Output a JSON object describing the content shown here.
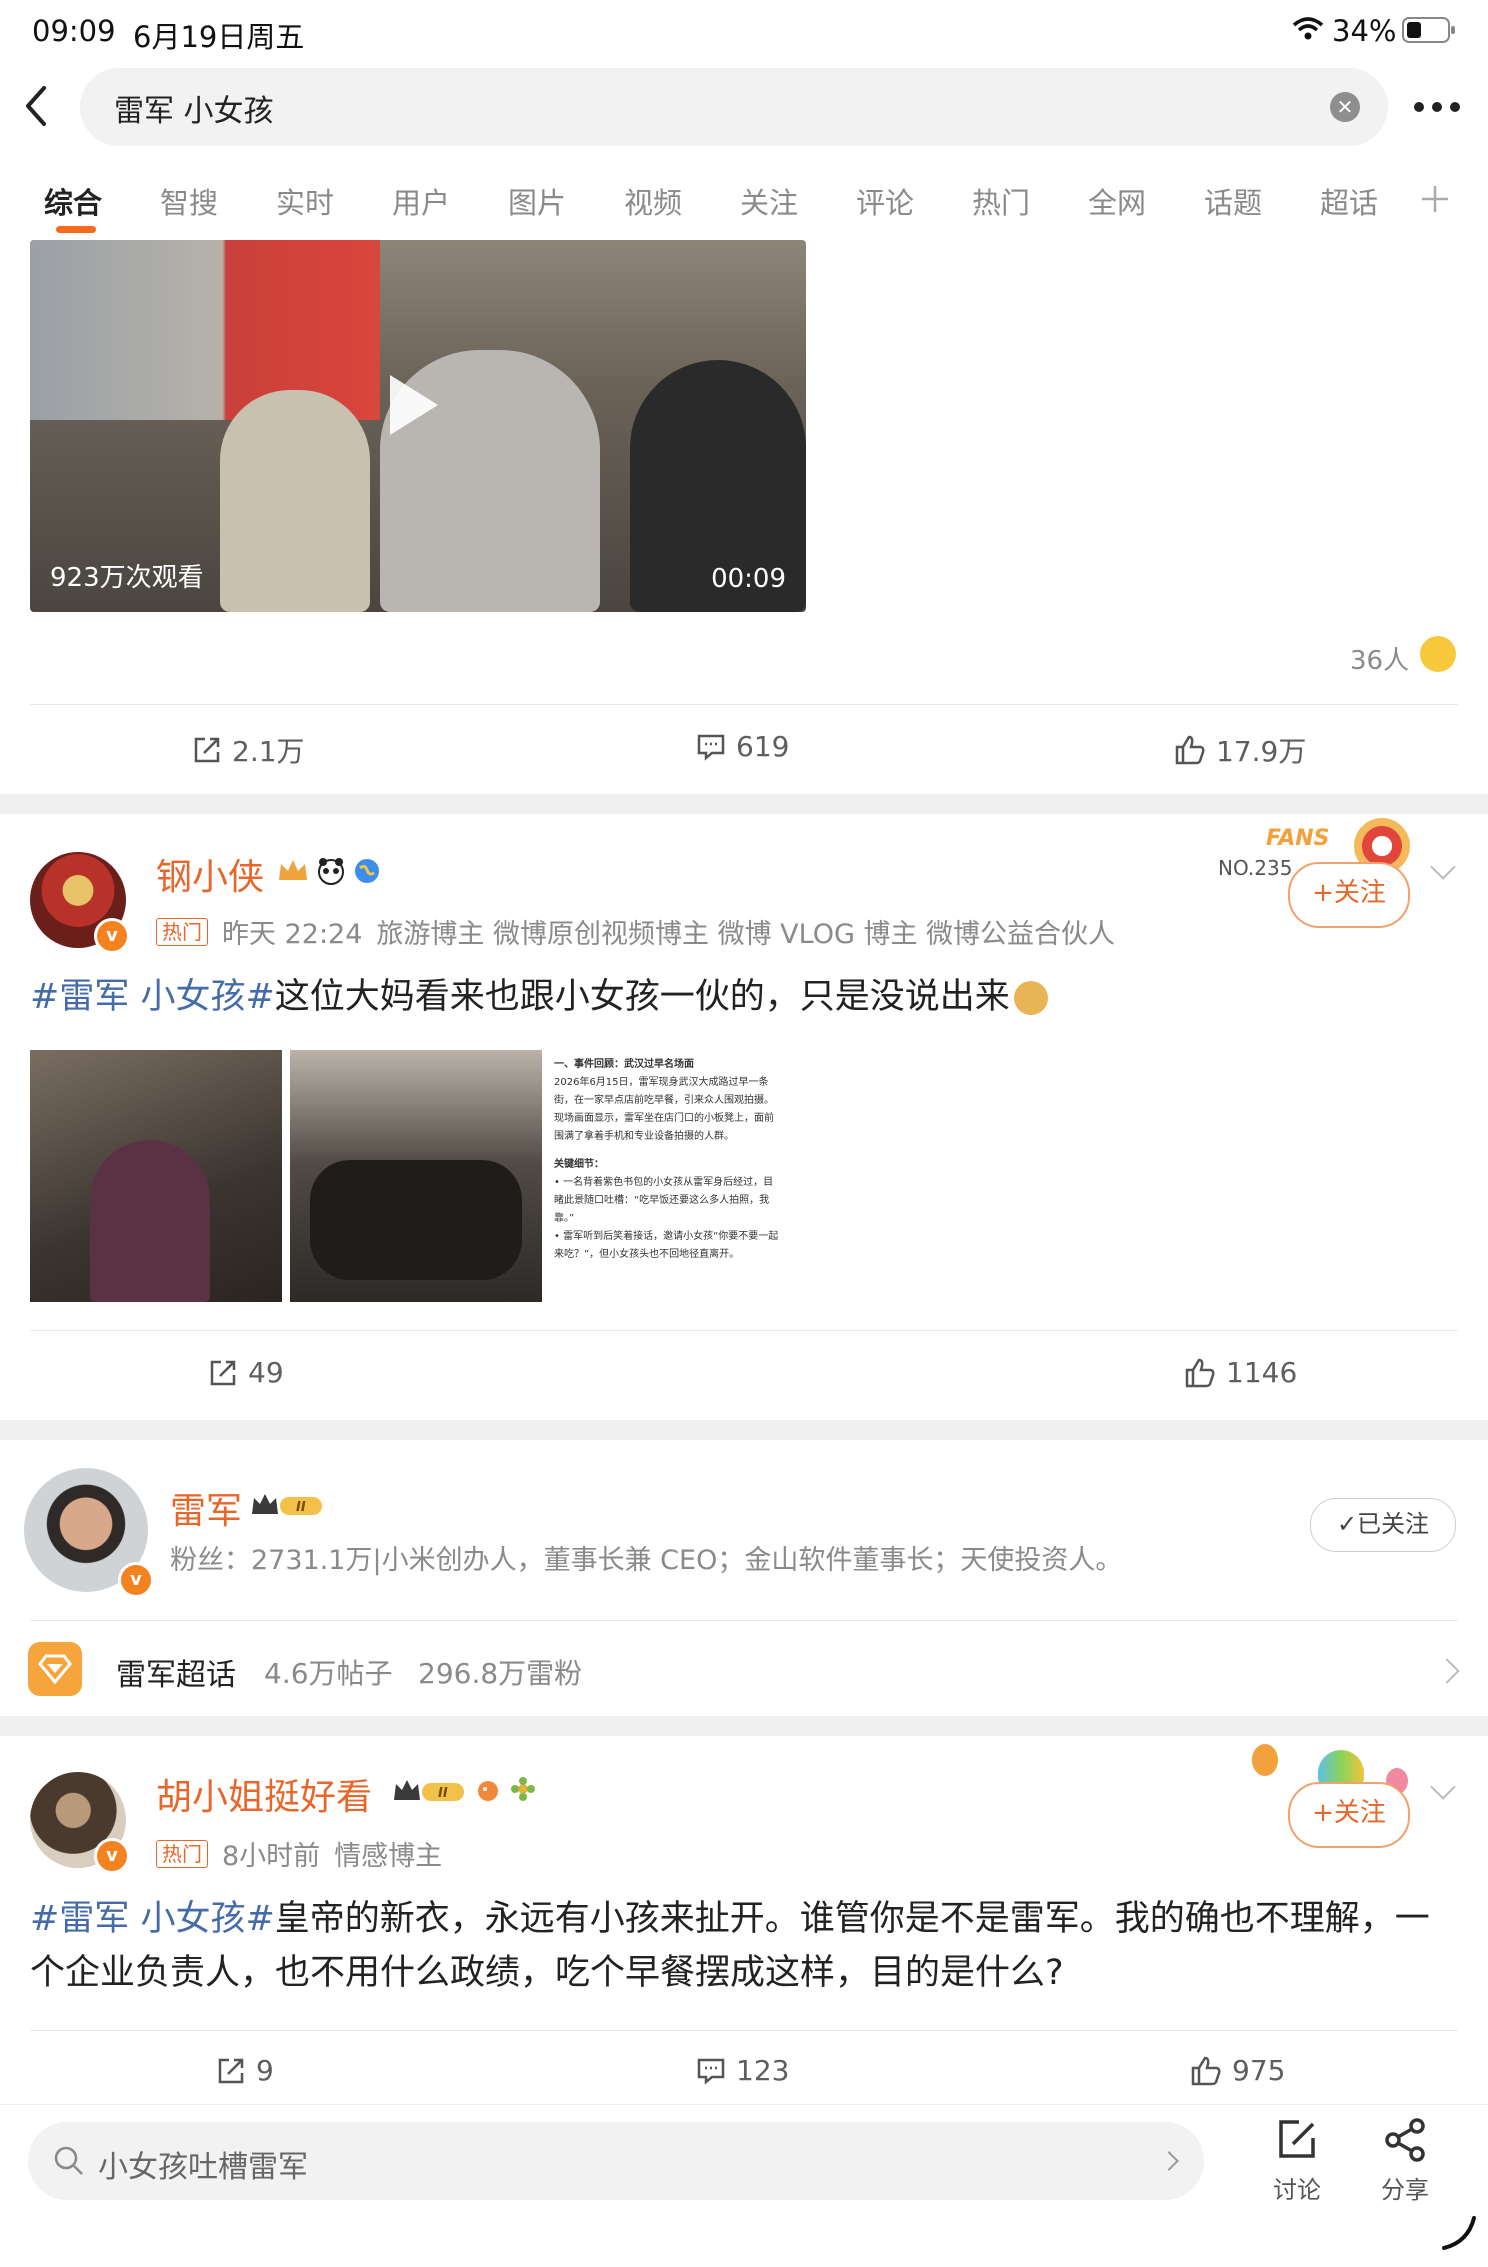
{
  "status_bar": {
    "time": "09:09",
    "date": "6月19日周五",
    "battery": "34%"
  },
  "search": {
    "query": "雷军 小女孩"
  },
  "tabs": [
    "综合",
    "智搜",
    "实时",
    "用户",
    "图片",
    "视频",
    "关注",
    "评论",
    "热门",
    "全网",
    "话题",
    "超话"
  ],
  "active_tab": "综合",
  "video_post": {
    "views": "923万次观看",
    "duration": "00:09",
    "reactions_count": "36人",
    "repost": "2.1万",
    "comments": "619",
    "likes": "17.9万"
  },
  "post2": {
    "user": "钢小侠",
    "hot_tag": "热门",
    "time": "昨天 22:24",
    "roles": "旅游博主 微博原创视频博主 微博 VLOG 博主 微博公益合伙人",
    "fans_badge": "FANS",
    "fans_no": "NO.235",
    "follow": "+关注",
    "hashtag": "#雷军 小女孩#",
    "text": "这位大妈看来也跟小女孩一伙的，只是没说出来",
    "doc_lines": [
      "一、事件回顾：武汉过早名场面",
      "2026年6月15日，雷军现身武汉大成路过早一条",
      "街，在一家早点店前吃早餐，引来众人围观拍摄。",
      "现场画面显示，雷军坐在店门口的小板凳上，面前",
      "围满了拿着手机和专业设备拍摄的人群。",
      "关键细节：",
      "• 一名背着紫色书包的小女孩从雷军身后经过，目",
      "睹此景随口吐槽：“吃早饭还要这么多人拍照，我",
      "靠。”",
      "• 雷军听到后笑着接话，邀请小女孩“你要不要一起",
      "来吃？”，但小女孩头也不回地径直离开。"
    ],
    "repost": "49",
    "likes": "1146"
  },
  "user_card": {
    "name": "雷军",
    "bio": "粉丝：2731.1万|小米创办人，董事长兼 CEO；金山软件董事长；天使投资人。",
    "followed": "✓已关注",
    "supertopic": "雷军超话",
    "posts": "4.6万帖子",
    "fans": "296.8万雷粉"
  },
  "post3": {
    "user": "胡小姐挺好看",
    "hot_tag": "热门",
    "time": "8小时前",
    "role": "情感博主",
    "follow": "+关注",
    "hashtag": "#雷军 小女孩#",
    "text": "皇帝的新衣，永远有小孩来扯开。谁管你是不是雷军。我的确也不理解，一个企业负责人，也不用什么政绩，吃个早餐摆成这样，目的是什么?",
    "repost": "9",
    "comments": "123",
    "likes": "975"
  },
  "bottom_bar": {
    "search_placeholder": "小女孩吐槽雷军",
    "discuss": "讨论",
    "share": "分享"
  },
  "colors": {
    "accent": "#e8662a",
    "hashtag": "#456ca8",
    "tab_indicator": "#f76a1c"
  }
}
